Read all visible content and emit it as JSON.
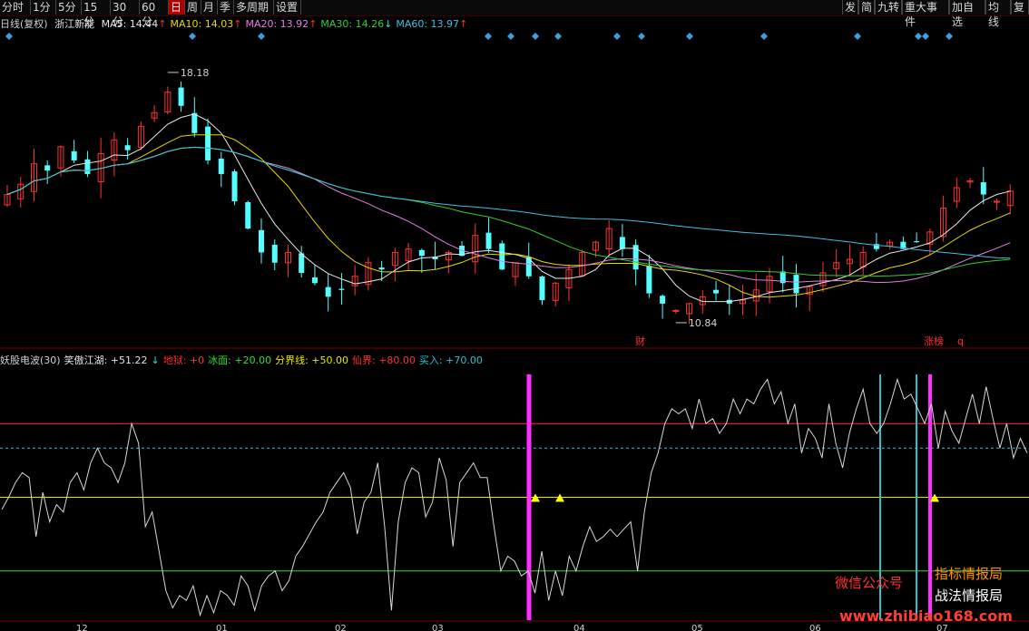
{
  "toolbar": {
    "left_items": [
      "分时",
      "1分",
      "5分",
      "15分",
      "30分",
      "60分",
      "日",
      "周",
      "月",
      "季",
      "多周期",
      "设置"
    ],
    "active": "日",
    "right_items": [
      "发",
      "简",
      "九转",
      "重大事件",
      "加自选",
      "均线",
      "复"
    ]
  },
  "stock": {
    "period_label": "日线(复权)",
    "name": "浙江新能"
  },
  "ma_legend": [
    {
      "label": "MA5:",
      "value": "14.44",
      "arrow": "↑",
      "color": "#e8e8e8",
      "arrow_color": "#ff3030"
    },
    {
      "label": "MA10:",
      "value": "14.03",
      "arrow": "↑",
      "color": "#e8d800",
      "arrow_color": "#ff3030"
    },
    {
      "label": "MA20:",
      "value": "13.92",
      "arrow": "↑",
      "color": "#e080e0",
      "arrow_color": "#ff3030"
    },
    {
      "label": "MA30:",
      "value": "14.26",
      "arrow": "↓",
      "color": "#30d030",
      "arrow_color": "#30e0e0"
    },
    {
      "label": "MA60:",
      "value": "13.97",
      "arrow": "↑",
      "color": "#40c0e0",
      "arrow_color": "#ff3030"
    }
  ],
  "indicator_legend": [
    {
      "text": "妖股电波(30)",
      "color": "#d0d0d0"
    },
    {
      "text": "笑傲江湖: +51.22",
      "color": "#e0e0e0"
    },
    {
      "text": "↓",
      "color": "#30e0e0"
    },
    {
      "text": "地狱: +0",
      "color": "#ff3030"
    },
    {
      "text": "冰面: +20.00",
      "color": "#30e030"
    },
    {
      "text": "分界线: +50.00",
      "color": "#e8e800"
    },
    {
      "text": "仙界: +80.00",
      "color": "#ff3030"
    },
    {
      "text": "买入: +70.00",
      "color": "#30c0d0"
    }
  ],
  "price_annotations": {
    "high": "18.18",
    "low": "10.84"
  },
  "event_marks": [
    "财",
    "涨榜",
    "q"
  ],
  "watermark": {
    "wechat": "微信公众号",
    "brand1": "指标情报局",
    "brand2": "战法情报局",
    "url": "www.zhibiao168.com"
  },
  "chart_data": [
    {
      "type": "candlestick",
      "title": "浙江新能 日线(复权)",
      "ylim": [
        10.2,
        19.4
      ],
      "x_ticks": [
        "12",
        "01",
        "02",
        "03",
        "04",
        "05",
        "06",
        "07"
      ],
      "highest": 18.18,
      "lowest": 10.84,
      "close_path": [
        14.6,
        14.9,
        15.5,
        15.3,
        16.0,
        15.6,
        15.2,
        15.8,
        16.2,
        15.9,
        16.6,
        17.0,
        17.6,
        17.2,
        16.4,
        15.6,
        15.2,
        14.4,
        13.6,
        12.9,
        12.6,
        12.9,
        12.3,
        12.0,
        11.6,
        11.8,
        12.2,
        12.6,
        12.4,
        12.9,
        13.0,
        12.8,
        12.7,
        12.9,
        12.8,
        13.4,
        13.0,
        12.4,
        12.6,
        12.2,
        11.5,
        12.0,
        12.4,
        12.9,
        13.2,
        13.6,
        13.0,
        12.4,
        11.7,
        11.4,
        11.2,
        11.4,
        11.6,
        11.7,
        11.4,
        11.5,
        11.8,
        12.2,
        12.0,
        11.7,
        11.9,
        12.3,
        12.6,
        12.7,
        12.9,
        13.0,
        13.2,
        13.0,
        13.2,
        13.5,
        14.2,
        14.8,
        15.0,
        14.6,
        14.4,
        14.7
      ]
    },
    {
      "type": "line",
      "title": "妖股电波(30)",
      "ylim": [
        0,
        100
      ],
      "x_ticks": [
        "12",
        "01",
        "02",
        "03",
        "04",
        "05",
        "06",
        "07"
      ],
      "reference_lines": [
        {
          "name": "仙界",
          "value": 80,
          "color": "#ff3030"
        },
        {
          "name": "买入",
          "value": 70,
          "color": "#30c0d0"
        },
        {
          "name": "分界线",
          "value": 50,
          "color": "#e8e800"
        },
        {
          "name": "冰面",
          "value": 20,
          "color": "#30e030"
        },
        {
          "name": "地狱",
          "value": 0,
          "color": "#ff3030"
        }
      ],
      "series": [
        {
          "name": "笑傲江湖",
          "values": [
            45,
            50,
            56,
            60,
            58,
            34,
            52,
            40,
            47,
            44,
            56,
            60,
            53,
            64,
            70,
            64,
            62,
            56,
            64,
            80,
            72,
            38,
            44,
            28,
            12,
            5,
            10,
            8,
            14,
            2,
            10,
            3,
            12,
            10,
            6,
            18,
            14,
            4,
            14,
            18,
            20,
            12,
            16,
            26,
            30,
            35,
            40,
            44,
            52,
            56,
            60,
            54,
            35,
            48,
            52,
            64,
            38,
            4,
            40,
            56,
            62,
            60,
            42,
            48,
            66,
            57,
            30,
            56,
            60,
            64,
            58,
            58,
            38,
            20,
            26,
            24,
            18,
            20,
            11,
            28,
            8,
            20,
            10,
            26,
            20,
            30,
            38,
            32,
            34,
            37,
            34,
            37,
            40,
            20,
            44,
            60,
            68,
            80,
            86,
            84,
            86,
            78,
            90,
            80,
            82,
            76,
            80,
            90,
            84,
            90,
            88,
            94,
            98,
            88,
            93,
            80,
            88,
            68,
            78,
            74,
            66,
            88,
            72,
            62,
            76,
            86,
            94,
            80,
            76,
            80,
            88,
            98,
            90,
            92,
            86,
            80,
            88,
            70,
            85,
            77,
            72,
            82,
            92,
            80,
            95,
            82,
            70,
            80,
            66,
            74,
            68
          ]
        }
      ]
    }
  ]
}
